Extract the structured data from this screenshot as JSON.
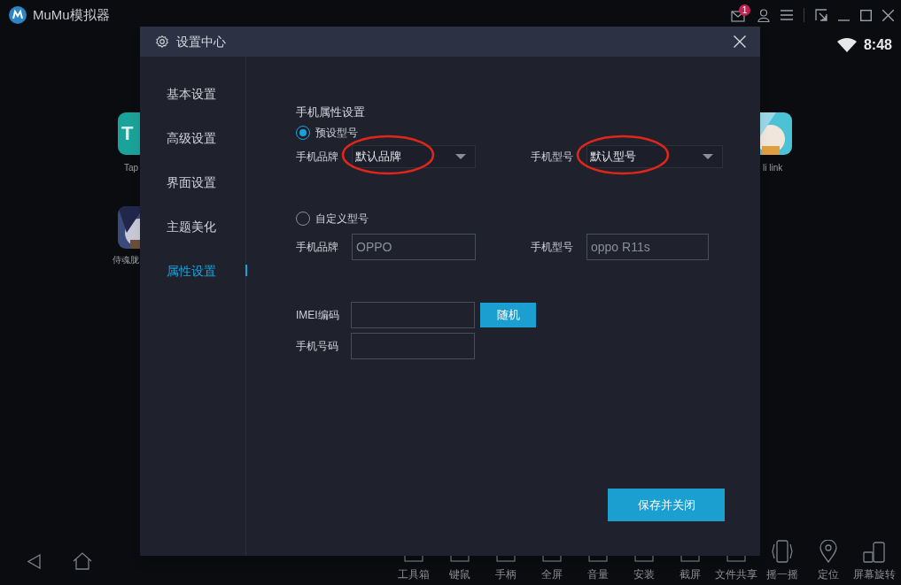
{
  "app": {
    "title": "MuMu模拟器",
    "mail_badge": "1",
    "clock": "8:48"
  },
  "desktop_apps": [
    {
      "kind": "tile",
      "tile_text": "T",
      "label": "Tap"
    },
    {
      "kind": "picture",
      "label": "侍魂胧"
    },
    {
      "kind": "picture",
      "label": "li link"
    }
  ],
  "dialog": {
    "title": "设置中心",
    "sidebar": [
      {
        "label": "基本设置",
        "selected": false
      },
      {
        "label": "高级设置",
        "selected": false
      },
      {
        "label": "界面设置",
        "selected": false
      },
      {
        "label": "主题美化",
        "selected": false
      },
      {
        "label": "属性设置",
        "selected": true
      }
    ],
    "section_title": "手机属性设置",
    "preset": {
      "label": "预设型号",
      "selected": true,
      "fields": [
        {
          "label": "手机品牌",
          "value": "默认品牌",
          "highlighted": true
        },
        {
          "label": "手机型号",
          "value": "默认型号",
          "highlighted": true
        }
      ]
    },
    "custom": {
      "label": "自定义型号",
      "selected": false,
      "fields": [
        {
          "label": "手机品牌",
          "placeholder": "OPPO"
        },
        {
          "label": "手机型号",
          "placeholder": "oppo R11s"
        }
      ]
    },
    "imei": {
      "label": "IMEI编码",
      "button": "随机"
    },
    "phone": {
      "label": "手机号码"
    },
    "save_button": "保存并关闭"
  },
  "toolbar": [
    {
      "label": "工具箱"
    },
    {
      "label": "键鼠"
    },
    {
      "label": "手柄"
    },
    {
      "label": "全屏"
    },
    {
      "label": "音量"
    },
    {
      "label": "安装"
    },
    {
      "label": "截屏"
    },
    {
      "label": "文件共享"
    },
    {
      "label": "摇一摇"
    },
    {
      "label": "定位"
    },
    {
      "label": "屏幕旋转"
    }
  ]
}
